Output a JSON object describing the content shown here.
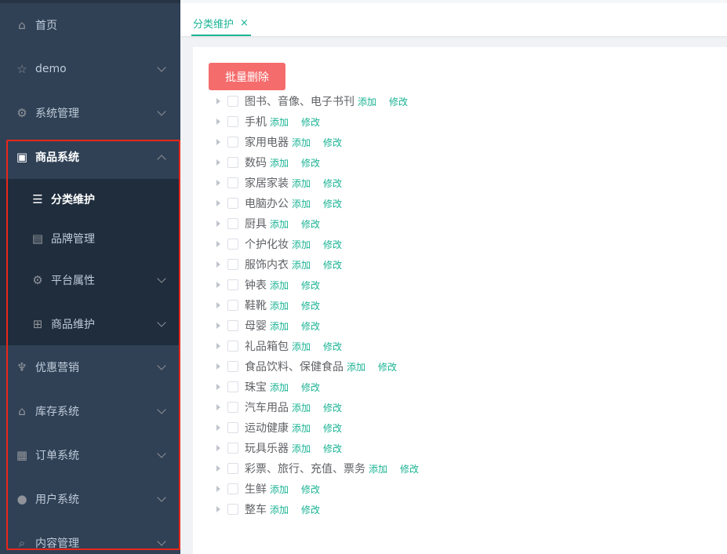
{
  "sidebar": {
    "items": [
      {
        "label": "首页",
        "icon": "home-icon"
      },
      {
        "label": "demo",
        "icon": "star-icon"
      },
      {
        "label": "系统管理",
        "icon": "gear-icon"
      },
      {
        "label": "商品系统",
        "icon": "product-icon"
      },
      {
        "label": "优惠营销",
        "icon": "trophy-icon"
      },
      {
        "label": "库存系统",
        "icon": "home-icon"
      },
      {
        "label": "订单系统",
        "icon": "order-icon"
      },
      {
        "label": "用户系统",
        "icon": "user-icon"
      },
      {
        "label": "内容管理",
        "icon": "search-icon"
      }
    ],
    "submenu": [
      {
        "label": "分类维护",
        "icon": "list-icon"
      },
      {
        "label": "品牌管理",
        "icon": "brand-icon"
      },
      {
        "label": "平台属性",
        "icon": "gear-icon"
      },
      {
        "label": "商品维护",
        "icon": "grid-icon"
      }
    ]
  },
  "tabs": {
    "active": {
      "label": "分类维护",
      "close": "×"
    }
  },
  "toolbar": {
    "batch_delete_label": "批量删除"
  },
  "tree": {
    "add_label": "添加",
    "edit_label": "修改",
    "nodes": [
      "图书、音像、电子书刊",
      "手机",
      "家用电器",
      "数码",
      "家居家装",
      "电脑办公",
      "厨具",
      "个护化妆",
      "服饰内衣",
      "钟表",
      "鞋靴",
      "母婴",
      "礼品箱包",
      "食品饮料、保健食品",
      "珠宝",
      "汽车用品",
      "运动健康",
      "玩具乐器",
      "彩票、旅行、充值、票务",
      "生鲜",
      "整车"
    ]
  },
  "colors": {
    "sidebar_bg": "#304156",
    "submenu_bg": "#1f2d3d",
    "accent": "#1ab394",
    "danger": "#f56c6c",
    "highlight_box": "#e8271b"
  }
}
